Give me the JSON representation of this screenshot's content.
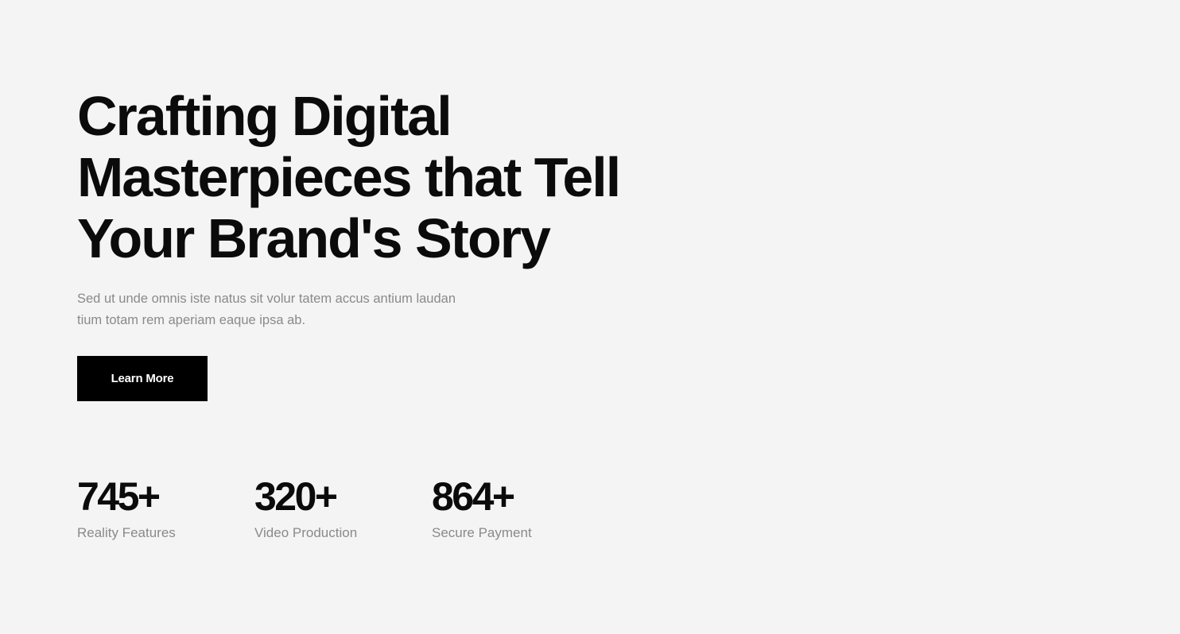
{
  "hero": {
    "title_lines": [
      "Crafting Digital",
      "Masterpieces that Tell",
      "Your Brand's Story"
    ],
    "description_lines": [
      "Sed ut unde omnis iste natus sit volur tatem accus antium laudan",
      "tium totam rem aperiam eaque ipsa ab."
    ],
    "cta_label": "Learn More"
  },
  "stats": [
    {
      "value": "745+",
      "label": "Reality Features"
    },
    {
      "value": "320+",
      "label": "Video Production"
    },
    {
      "value": "864+",
      "label": "Secure Payment"
    }
  ],
  "colors": {
    "background": "#f4f4f4",
    "heading": "#0b0b0b",
    "muted_text": "#8a8a8a",
    "button_background": "#000000",
    "button_text": "#ffffff"
  }
}
